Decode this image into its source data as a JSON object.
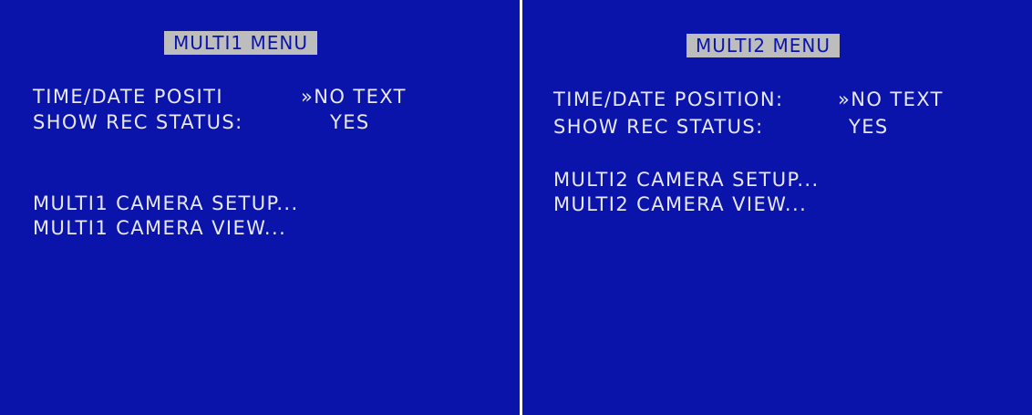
{
  "left_screen": {
    "title": "MULTI1 MENU",
    "time_date_label": "TIME/DATE POSITI",
    "time_date_value": "»NO TEXT",
    "show_rec_label": "SHOW REC STATUS:",
    "show_rec_value": "YES",
    "camera_setup": "MULTI1 CAMERA SETUP...",
    "camera_view": "MULTI1 CAMERA VIEW..."
  },
  "right_screen": {
    "title": "MULTI2 MENU",
    "time_date_label": "TIME/DATE POSITION:",
    "time_date_value": "»NO TEXT",
    "show_rec_label": "SHOW REC STATUS:",
    "show_rec_value": "YES",
    "camera_setup": "MULTI2 CAMERA SETUP...",
    "camera_view": "MULTI2 CAMERA VIEW..."
  },
  "colors": {
    "screen_background": "#0a14ab",
    "text": "#e8e8f4",
    "title_highlight": "#bdbdbd"
  }
}
